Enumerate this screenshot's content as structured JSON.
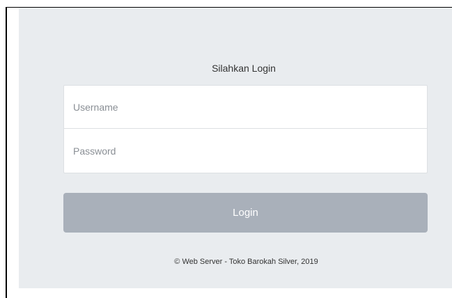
{
  "login_form": {
    "title": "Silahkan Login",
    "username_placeholder": "Username",
    "password_placeholder": "Password",
    "login_label": "Login"
  },
  "footer": {
    "text": "© Web Server - Toko Barokah Silver, 2019"
  },
  "colors": {
    "panel_background": "#e9ecef",
    "button_background": "#a9b0ba",
    "input_background": "#ffffff"
  }
}
